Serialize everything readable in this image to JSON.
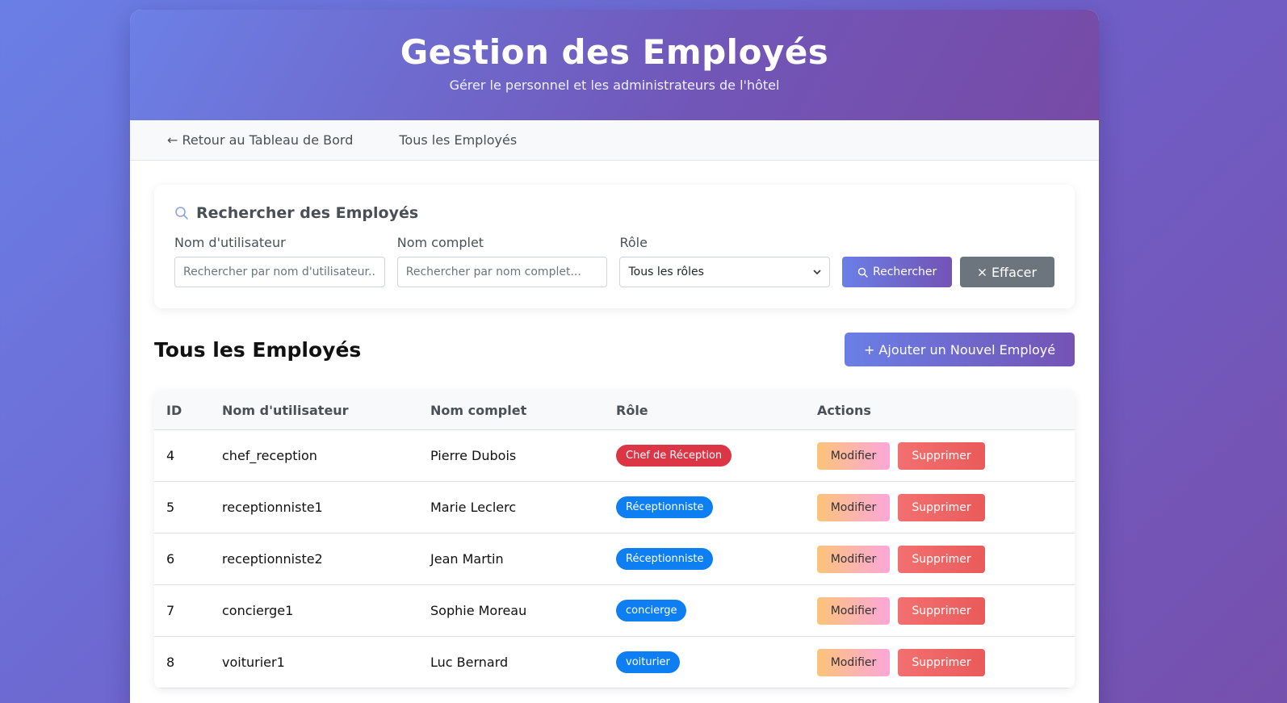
{
  "header": {
    "title": "Gestion des Employés",
    "subtitle": "Gérer le personnel et les administrateurs de l'hôtel"
  },
  "nav": {
    "back_label": "← Retour au Tableau de Bord",
    "all_label": "Tous les Employés"
  },
  "search": {
    "title": "Rechercher des Employés",
    "username_label": "Nom d'utilisateur",
    "username_placeholder": "Rechercher par nom d'utilisateur...",
    "fullname_label": "Nom complet",
    "fullname_placeholder": "Rechercher par nom complet...",
    "role_label": "Rôle",
    "role_selected": "Tous les rôles",
    "search_button": "Rechercher",
    "clear_button": "Effacer"
  },
  "list": {
    "title": "Tous les Employés",
    "add_button": "+ Ajouter un Nouvel Employé"
  },
  "table": {
    "headers": [
      "ID",
      "Nom d'utilisateur",
      "Nom complet",
      "Rôle",
      "Actions"
    ],
    "edit_label": "Modifier",
    "delete_label": "Supprimer",
    "rows": [
      {
        "id": "4",
        "username": "chef_reception",
        "fullname": "Pierre Dubois",
        "role": "Chef de Réception",
        "role_color": "#dc3545"
      },
      {
        "id": "5",
        "username": "receptionniste1",
        "fullname": "Marie Leclerc",
        "role": "Réceptionniste",
        "role_color": "#0d7ff2"
      },
      {
        "id": "6",
        "username": "receptionniste2",
        "fullname": "Jean Martin",
        "role": "Réceptionniste",
        "role_color": "#0d7ff2"
      },
      {
        "id": "7",
        "username": "concierge1",
        "fullname": "Sophie Moreau",
        "role": "concierge",
        "role_color": "#0d7ff2"
      },
      {
        "id": "8",
        "username": "voiturier1",
        "fullname": "Luc Bernard",
        "role": "voiturier",
        "role_color": "#0d7ff2"
      }
    ]
  },
  "colors": {
    "accent_start": "#6a7fe6",
    "accent_end": "#7453b5",
    "danger": "#dc3545",
    "primary_badge": "#0d7ff2",
    "secondary": "#6c757d"
  }
}
